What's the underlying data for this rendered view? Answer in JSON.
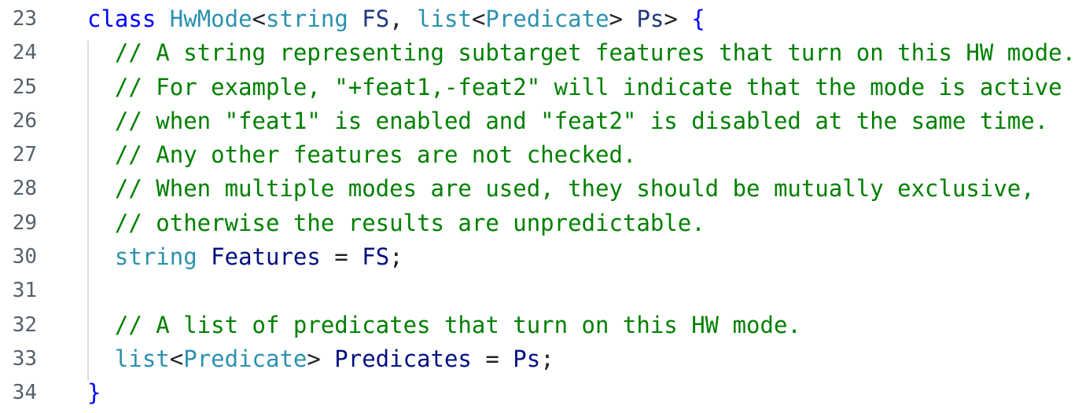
{
  "editor": {
    "lines": [
      {
        "n": "23",
        "t": [
          {
            "c": "kw",
            "v": "class"
          },
          {
            "c": "punct",
            "v": " "
          },
          {
            "c": "type",
            "v": "HwMode"
          },
          {
            "c": "punct",
            "v": "<"
          },
          {
            "c": "type",
            "v": "string"
          },
          {
            "c": "punct",
            "v": " "
          },
          {
            "c": "tparam",
            "v": "FS"
          },
          {
            "c": "punct",
            "v": ", "
          },
          {
            "c": "type",
            "v": "list"
          },
          {
            "c": "punct",
            "v": "<"
          },
          {
            "c": "type",
            "v": "Predicate"
          },
          {
            "c": "punct",
            "v": "> "
          },
          {
            "c": "tparam",
            "v": "Ps"
          },
          {
            "c": "punct",
            "v": "> "
          },
          {
            "c": "brace",
            "v": "{"
          }
        ]
      },
      {
        "n": "24",
        "t": [
          {
            "c": "punct",
            "v": "  "
          },
          {
            "c": "comment",
            "v": "// A string representing subtarget features that turn on this HW mode."
          }
        ]
      },
      {
        "n": "25",
        "t": [
          {
            "c": "punct",
            "v": "  "
          },
          {
            "c": "comment",
            "v": "// For example, \"+feat1,-feat2\" will indicate that the mode is active"
          }
        ]
      },
      {
        "n": "26",
        "t": [
          {
            "c": "punct",
            "v": "  "
          },
          {
            "c": "comment",
            "v": "// when \"feat1\" is enabled and \"feat2\" is disabled at the same time."
          }
        ]
      },
      {
        "n": "27",
        "t": [
          {
            "c": "punct",
            "v": "  "
          },
          {
            "c": "comment",
            "v": "// Any other features are not checked."
          }
        ]
      },
      {
        "n": "28",
        "t": [
          {
            "c": "punct",
            "v": "  "
          },
          {
            "c": "comment",
            "v": "// When multiple modes are used, they should be mutually exclusive,"
          }
        ]
      },
      {
        "n": "29",
        "t": [
          {
            "c": "punct",
            "v": "  "
          },
          {
            "c": "comment",
            "v": "// otherwise the results are unpredictable."
          }
        ]
      },
      {
        "n": "30",
        "t": [
          {
            "c": "punct",
            "v": "  "
          },
          {
            "c": "type",
            "v": "string"
          },
          {
            "c": "punct",
            "v": " "
          },
          {
            "c": "ident",
            "v": "Features"
          },
          {
            "c": "punct",
            "v": " = "
          },
          {
            "c": "ident",
            "v": "FS"
          },
          {
            "c": "punct",
            "v": ";"
          }
        ]
      },
      {
        "n": "31",
        "t": []
      },
      {
        "n": "32",
        "t": [
          {
            "c": "punct",
            "v": "  "
          },
          {
            "c": "comment",
            "v": "// A list of predicates that turn on this HW mode."
          }
        ]
      },
      {
        "n": "33",
        "t": [
          {
            "c": "punct",
            "v": "  "
          },
          {
            "c": "type",
            "v": "list"
          },
          {
            "c": "punct",
            "v": "<"
          },
          {
            "c": "type",
            "v": "Predicate"
          },
          {
            "c": "punct",
            "v": "> "
          },
          {
            "c": "ident",
            "v": "Predicates"
          },
          {
            "c": "punct",
            "v": " = "
          },
          {
            "c": "ident",
            "v": "Ps"
          },
          {
            "c": "punct",
            "v": ";"
          }
        ]
      },
      {
        "n": "34",
        "t": [
          {
            "c": "brace",
            "v": "}"
          }
        ]
      }
    ]
  },
  "colors": {
    "keyword": "#0000ff",
    "type": "#2b91af",
    "template_param": "#1f377f",
    "comment": "#008000",
    "identifier": "#001080",
    "line_number": "#57606a",
    "indent_guide": "#d8dee4",
    "background": "#ffffff"
  }
}
